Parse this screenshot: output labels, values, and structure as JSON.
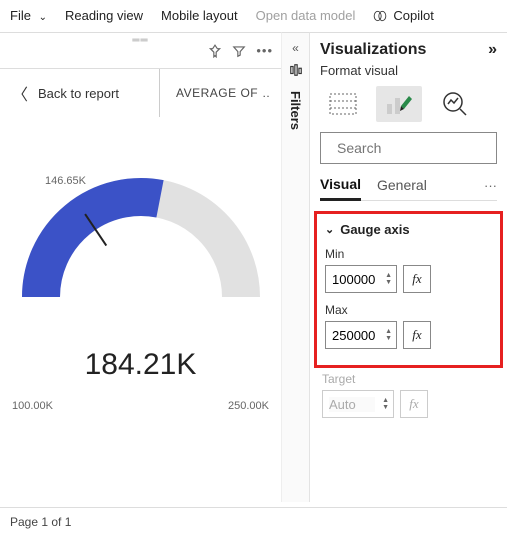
{
  "topbar": {
    "file": "File",
    "reading_view": "Reading view",
    "mobile_layout": "Mobile layout",
    "open_data_model": "Open data model",
    "copilot": "Copilot"
  },
  "canvas": {
    "back_label": "Back to report",
    "subtitle": "AVERAGE OF …"
  },
  "gauge": {
    "min_label": "100.00K",
    "max_label": "250.00K",
    "value_label": "184.21K",
    "marker_label": "146.65K"
  },
  "chart_data": {
    "type": "gauge",
    "title": "AVERAGE OF …",
    "min": 100000,
    "max": 250000,
    "value": 184210,
    "target": 146650,
    "value_display": "184.21K",
    "min_display": "100.00K",
    "max_display": "250.00K",
    "target_display": "146.65K",
    "fill_color": "#3b52c7",
    "track_color": "#e1e1e1"
  },
  "filters_label": "Filters",
  "pane": {
    "title": "Visualizations",
    "subtitle": "Format visual",
    "search_placeholder": "Search",
    "tabs": {
      "visual": "Visual",
      "general": "General"
    },
    "section": "Gauge axis",
    "min_label": "Min",
    "min_value": "100000",
    "max_label": "Max",
    "max_value": "250000",
    "target_label": "Target",
    "target_value": "Auto",
    "fx": "fx"
  },
  "footer": {
    "page": "Page 1 of 1"
  }
}
